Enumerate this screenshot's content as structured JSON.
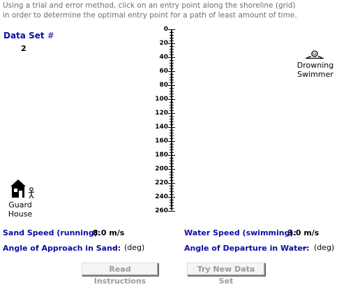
{
  "instructions": [
    "Using a trial and error method, click on an entry point along the shoreline (grid)",
    "in order to determine the optimal entry point  for a path of least amount of time."
  ],
  "dataset": {
    "label": "Data Set",
    "hash": "#",
    "number": "2"
  },
  "grid": {
    "labels": [
      "0",
      "20",
      "40",
      "60",
      "80",
      "100",
      "120",
      "140",
      "160",
      "180",
      "200",
      "220",
      "240",
      "260"
    ]
  },
  "swimmer": {
    "label_line1": "Drowning",
    "label_line2": "Swimmer"
  },
  "guard": {
    "label_line1": "Guard",
    "label_line2": "House"
  },
  "fields": {
    "sand_speed_label": "Sand Speed (running):",
    "sand_speed_value": "8.0 m/s",
    "water_speed_label": "Water Speed (swimming):",
    "water_speed_value": "3.0 m/s",
    "approach_label": "Angle of Approach in Sand:",
    "approach_value": "--",
    "approach_unit": "(deg)",
    "departure_label": "Angle of Departure in Water:",
    "departure_value": "--",
    "departure_unit": "(deg)"
  },
  "buttons": {
    "read_instructions": "Read Instructions",
    "try_new_data_set": "Try New Data Set"
  }
}
